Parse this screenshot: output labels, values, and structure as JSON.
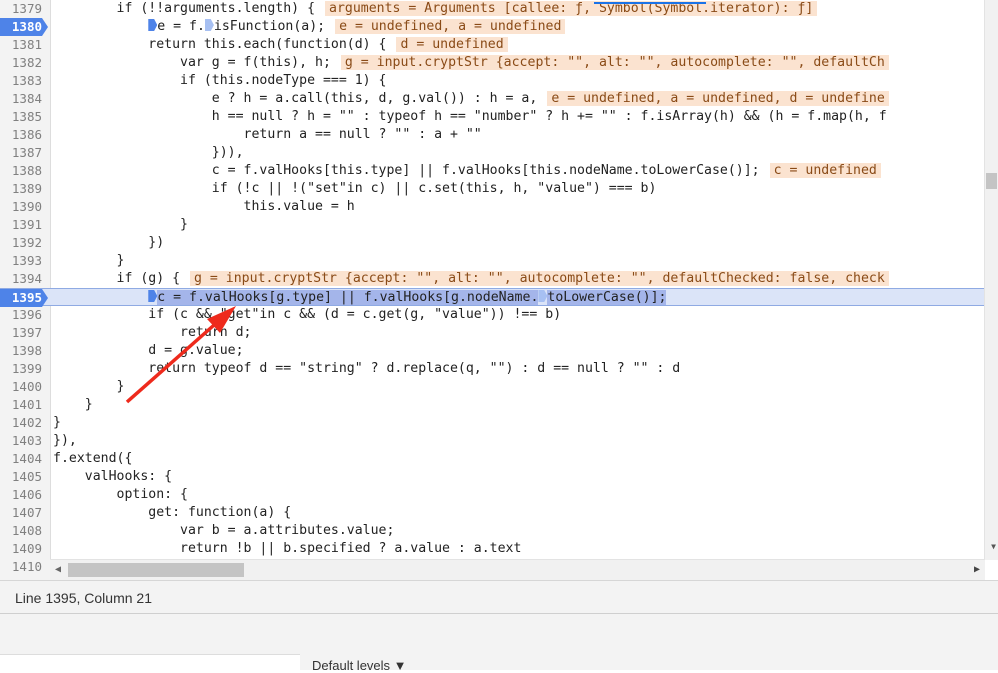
{
  "editor": {
    "lines": [
      {
        "n": "1379",
        "code": "        if (!!arguments.length) {",
        "inline": "arguments = Arguments [callee: ƒ, Symbol(Symbol.iterator): ƒ]"
      },
      {
        "n": "1380",
        "bp": true,
        "pre": "            ",
        "m1": true,
        "code": "e = f.",
        "m2": true,
        "post": "isFunction(a);",
        "inline": "e = undefined, a = undefined"
      },
      {
        "n": "1381",
        "code": "            return this.each(function(d) {",
        "inline": "d = undefined"
      },
      {
        "n": "1382",
        "code": "                var g = f(this), h;",
        "inline": "g = input.cryptStr {accept: \"\", alt: \"\", autocomplete: \"\", defaultCh"
      },
      {
        "n": "1383",
        "code": "                if (this.nodeType === 1) {"
      },
      {
        "n": "1384",
        "code": "                    e ? h = a.call(this, d, g.val()) : h = a,",
        "inline": "e = undefined, a = undefined, d = undefine"
      },
      {
        "n": "1385",
        "code": "                    h == null ? h = \"\" : typeof h == \"number\" ? h += \"\" : f.isArray(h) && (h = f.map(h, f"
      },
      {
        "n": "1386",
        "code": "                        return a == null ? \"\" : a + \"\""
      },
      {
        "n": "1387",
        "code": "                    })),"
      },
      {
        "n": "1388",
        "code": "                    c = f.valHooks[this.type] || f.valHooks[this.nodeName.toLowerCase()];",
        "inline": "c = undefined"
      },
      {
        "n": "1389",
        "code": "                    if (!c || !(\"set\"in c) || c.set(this, h, \"value\") === b)"
      },
      {
        "n": "1390",
        "code": "                        this.value = h"
      },
      {
        "n": "1391",
        "code": "                }"
      },
      {
        "n": "1392",
        "code": "            })"
      },
      {
        "n": "1393",
        "code": "        }"
      },
      {
        "n": "1394",
        "code": "        if (g) {",
        "inline": "g = input.cryptStr {accept: \"\", alt: \"\", autocomplete: \"\", defaultChecked: false, check"
      },
      {
        "n": "1395",
        "bp": true,
        "paused": true,
        "pre": "            ",
        "m1": true,
        "sel1": "c = f.valHooks[g.type] || f.valHooks[g.nodeName.",
        "m2": true,
        "sel2": "toLowerCase()];"
      },
      {
        "n": "1396",
        "code": "            if (c && \"get\"in c && (d = c.get(g, \"value\")) !== b)"
      },
      {
        "n": "1397",
        "code": "                return d;"
      },
      {
        "n": "1398",
        "code": "            d = g.value;"
      },
      {
        "n": "1399",
        "code": "            return typeof d == \"string\" ? d.replace(q, \"\") : d == null ? \"\" : d"
      },
      {
        "n": "1400",
        "code": "        }"
      },
      {
        "n": "1401",
        "code": "    }"
      },
      {
        "n": "1402",
        "code": "}"
      },
      {
        "n": "1403",
        "code": "}),"
      },
      {
        "n": "1404",
        "code": "f.extend({"
      },
      {
        "n": "1405",
        "code": "    valHooks: {"
      },
      {
        "n": "1406",
        "code": "        option: {"
      },
      {
        "n": "1407",
        "code": "            get: function(a) {"
      },
      {
        "n": "1408",
        "code": "                var b = a.attributes.value;"
      },
      {
        "n": "1409",
        "code": "                return !b || b.specified ? a.value : a.text"
      },
      {
        "n": "1410",
        "code": "            },"
      }
    ]
  },
  "status": {
    "position": "Line 1395, Column 21"
  },
  "console": {
    "levels_label": "Default levels ▼"
  },
  "scroll": {
    "left": "◀",
    "right": "▶",
    "down": "▼"
  }
}
